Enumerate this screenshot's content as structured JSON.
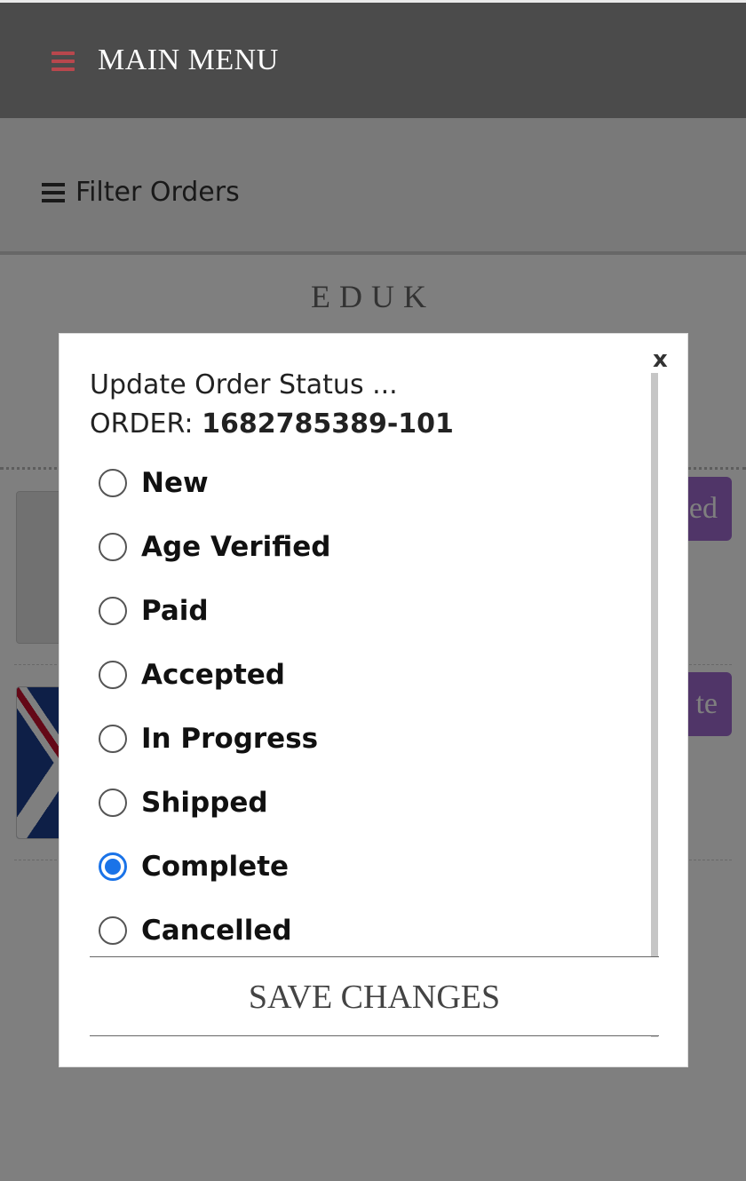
{
  "header": {
    "title": "MAIN MENU",
    "menu_icon": "hamburger-icon",
    "accent_color": "#b8474d"
  },
  "filter": {
    "label": "Filter Orders",
    "icon": "hamburger-icon"
  },
  "store": {
    "name": "EDUK",
    "subtitle": ""
  },
  "orders": [
    {
      "status_label": "ed",
      "status_color": "#a06ad0"
    },
    {
      "status_label": "te",
      "status_color": "#a06ad0"
    }
  ],
  "modal": {
    "title": "Update Order Status ...",
    "order_prefix": "ORDER:",
    "order_number": "1682785389-101",
    "close_label": "x",
    "options": [
      {
        "label": "New",
        "checked": false
      },
      {
        "label": "Age Verified",
        "checked": false
      },
      {
        "label": "Paid",
        "checked": false
      },
      {
        "label": "Accepted",
        "checked": false
      },
      {
        "label": "In Progress",
        "checked": false
      },
      {
        "label": "Shipped",
        "checked": false
      },
      {
        "label": "Complete",
        "checked": true
      },
      {
        "label": "Cancelled",
        "checked": false
      }
    ],
    "save_label": "SAVE CHANGES",
    "selected_color": "#1a73e8"
  }
}
